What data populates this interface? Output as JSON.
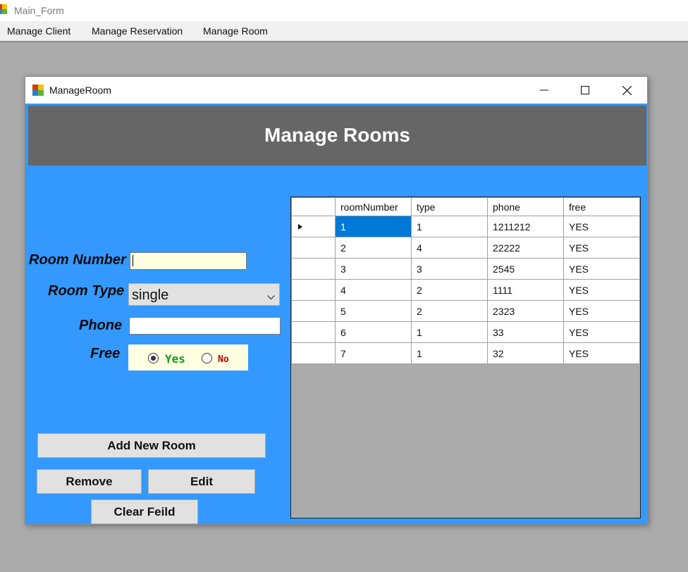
{
  "main_window": {
    "title": "Main_Form",
    "menu": [
      "Manage Client",
      "Manage Reservation",
      "Manage Room"
    ]
  },
  "child_window": {
    "title": "ManageRoom",
    "heading": "Manage Rooms"
  },
  "form": {
    "room_number_label": "Room Number",
    "room_number_value": "",
    "room_type_label": "Room Type",
    "room_type_value": "single",
    "phone_label": "Phone",
    "phone_value": "",
    "free_label": "Free",
    "free_yes": "Yes",
    "free_no": "No",
    "free_selected": "Yes"
  },
  "buttons": {
    "add": "Add New Room",
    "remove": "Remove",
    "edit": "Edit",
    "clear": "Clear Feild"
  },
  "grid": {
    "columns": [
      "roomNumber",
      "type",
      "phone",
      "free"
    ],
    "rows": [
      [
        "1",
        "1",
        "1211212",
        "YES"
      ],
      [
        "2",
        "4",
        "22222",
        "YES"
      ],
      [
        "3",
        "3",
        "2545",
        "YES"
      ],
      [
        "4",
        "2",
        "1111",
        "YES"
      ],
      [
        "5",
        "2",
        "2323",
        "YES"
      ],
      [
        "6",
        "1",
        "33",
        "YES"
      ],
      [
        "7",
        "1",
        "32",
        "YES"
      ]
    ],
    "selected_row": 0
  },
  "icons": {
    "app": "app-icon",
    "minimize": "minimize-icon",
    "maximize": "maximize-icon",
    "close": "close-icon",
    "dropdown": "chevron-down-icon",
    "row_pointer": "row-pointer-icon"
  },
  "colors": {
    "form_background": "#3399ff",
    "header_background": "#666666",
    "selection": "#0078d7",
    "yes_text": "#10a010",
    "no_text": "#c00000"
  }
}
